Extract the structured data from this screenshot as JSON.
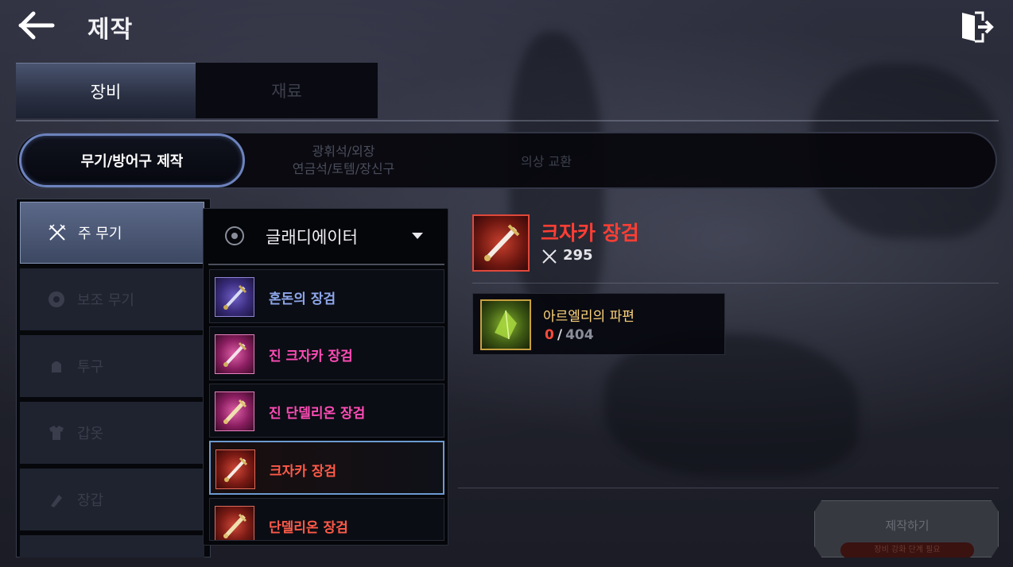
{
  "header": {
    "title": "제작",
    "back_icon": "arrow-left-icon",
    "exit_icon": "exit-door-icon"
  },
  "main_tabs": [
    {
      "label": "장비",
      "active": true
    },
    {
      "label": "재료",
      "active": false
    }
  ],
  "sub_tabs": [
    {
      "label": "무기/방어구 제작",
      "active": true
    },
    {
      "label_line1": "광휘석/외장",
      "label_line2": "연금석/토템/장신구",
      "active": false
    },
    {
      "label": "의상 교환",
      "active": false
    }
  ],
  "categories": [
    {
      "label": "주 무기",
      "icon": "crossed-swords-icon",
      "active": true
    },
    {
      "label": "보조 무기",
      "icon": "shield-icon",
      "active": false
    },
    {
      "label": "투구",
      "icon": "helmet-icon",
      "active": false
    },
    {
      "label": "갑옷",
      "icon": "armor-icon",
      "active": false
    },
    {
      "label": "장갑",
      "icon": "glove-icon",
      "active": false
    }
  ],
  "class_select": {
    "value": "글래디에이터",
    "icon": "radio-icon",
    "caret": "chevron-down-icon"
  },
  "items": [
    {
      "name": "혼돈의 장검",
      "grade_color": "#8ea8ec",
      "selected": false
    },
    {
      "name": "진 크자카 장검",
      "grade_color": "#ff4cb6",
      "selected": false
    },
    {
      "name": "진 단델리온 장검",
      "grade_color": "#ff4cb6",
      "selected": false
    },
    {
      "name": "크자카 장검",
      "grade_color": "#ff5a48",
      "selected": true
    },
    {
      "name": "단델리온 장검",
      "grade_color": "#ff5a48",
      "selected": false
    }
  ],
  "detail": {
    "name": "크자카 장검",
    "power": "295",
    "power_icon": "crossed-swords-icon"
  },
  "material": {
    "name": "아르엘리의 파편",
    "have": "0",
    "separator": "/",
    "need": "404"
  },
  "craft": {
    "label": "제작하기",
    "sub_label": "장비 강화 단계 필요"
  }
}
